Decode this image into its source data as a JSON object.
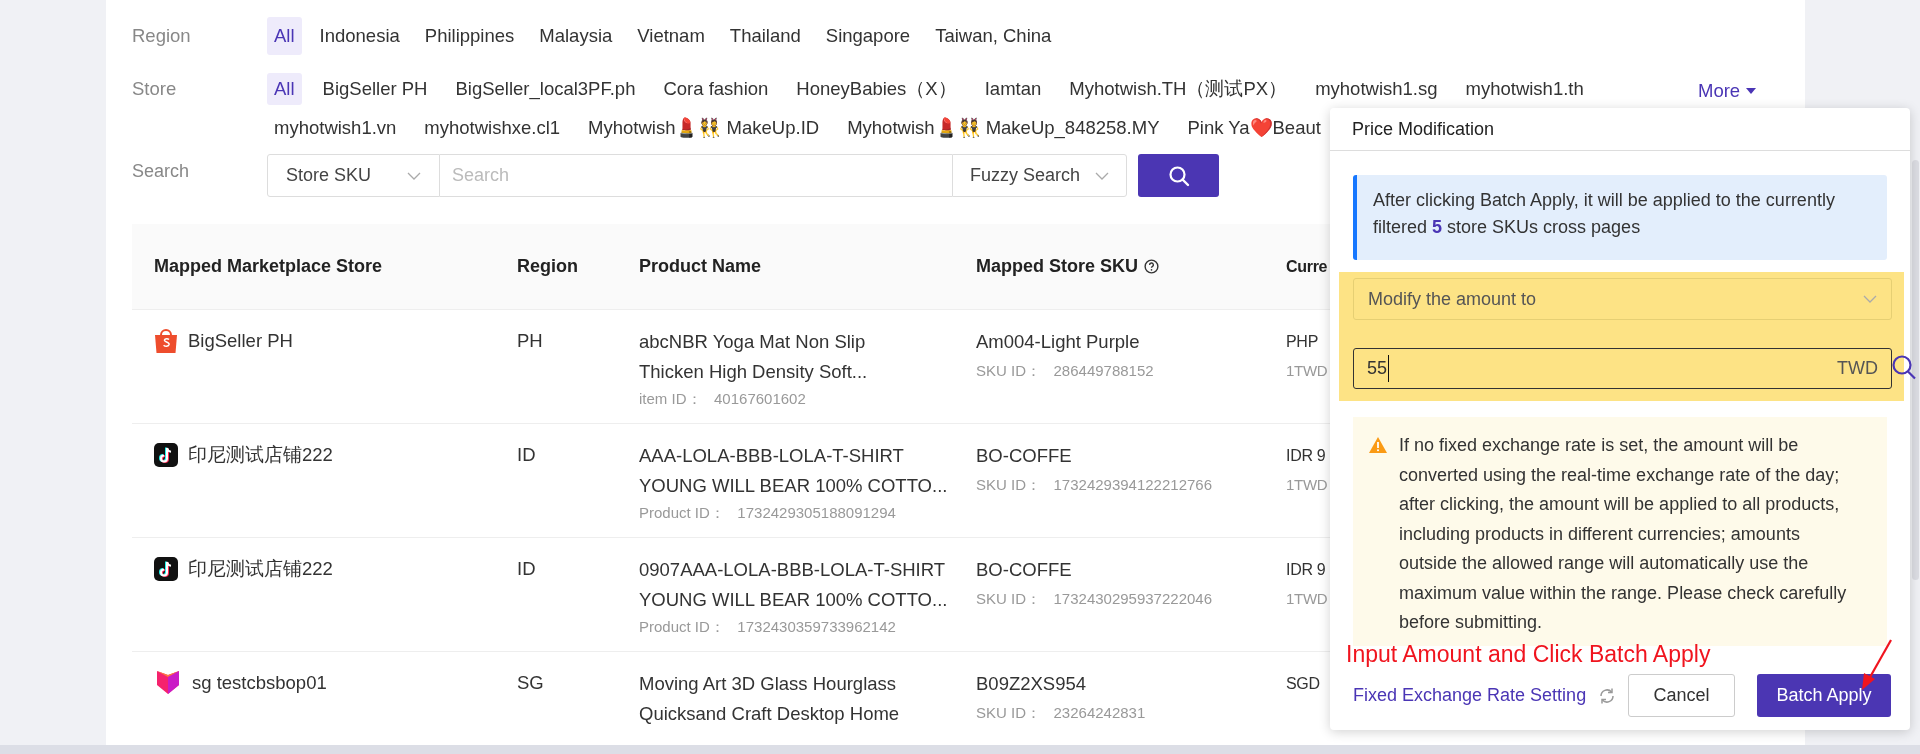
{
  "filters": {
    "region": {
      "label": "Region",
      "options": [
        {
          "label": "All",
          "selected": true
        },
        {
          "label": "Indonesia",
          "selected": false
        },
        {
          "label": "Philippines",
          "selected": false
        },
        {
          "label": "Malaysia",
          "selected": false
        },
        {
          "label": "Vietnam",
          "selected": false
        },
        {
          "label": "Thailand",
          "selected": false
        },
        {
          "label": "Singapore",
          "selected": false
        },
        {
          "label": "Taiwan, China",
          "selected": false
        }
      ]
    },
    "store": {
      "label": "Store",
      "more": "More",
      "options": [
        {
          "label": "All",
          "selected": true
        },
        {
          "label": "BigSeller PH",
          "selected": false
        },
        {
          "label": "BigSeller_local3PF.ph",
          "selected": false
        },
        {
          "label": "Cora fashion",
          "selected": false
        },
        {
          "label": "HoneyBabies（X）",
          "selected": false
        },
        {
          "label": "Iamtan",
          "selected": false
        },
        {
          "label": "Myhotwish.TH（测试PX）",
          "selected": false
        },
        {
          "label": "myhotwish1.sg",
          "selected": false
        },
        {
          "label": "myhotwish1.th",
          "selected": false
        },
        {
          "label": "myhotwish1.vn",
          "selected": false
        },
        {
          "label": "myhotwishxe.cl1",
          "selected": false
        },
        {
          "label": "Myhotwish💄👯 MakeUp.ID",
          "selected": false
        },
        {
          "label": "Myhotwish💄👯 MakeUp_848258.MY",
          "selected": false
        },
        {
          "label": "Pink Ya❤️Beaut",
          "selected": false
        }
      ]
    },
    "search": {
      "label": "Search",
      "field": "Store SKU",
      "placeholder": "Search",
      "match": "Fuzzy Search"
    }
  },
  "table": {
    "columns": [
      {
        "label": "Mapped Marketplace Store",
        "help": false
      },
      {
        "label": "Region",
        "help": false
      },
      {
        "label": "Product Name",
        "help": false
      },
      {
        "label": "Mapped Store SKU",
        "help": true
      },
      {
        "label": "Curre",
        "help": false
      }
    ],
    "rows": [
      {
        "store": {
          "kind": "shopee",
          "name": "BigSeller PH"
        },
        "region": "PH",
        "product": {
          "lines": [
            "abcNBR Yoga Mat Non Slip",
            "Thicken High Density Soft..."
          ],
          "id_label": "item ID：",
          "id": "40167601602"
        },
        "sku": {
          "name": "Am004-Light Purple",
          "id_label": "SKU ID：",
          "id": "286449788152"
        },
        "currency": [
          "PHP",
          "1TWD"
        ]
      },
      {
        "store": {
          "kind": "tiktok",
          "name": "印尼测试店铺222"
        },
        "region": "ID",
        "product": {
          "lines": [
            "AAA-LOLA-BBB-LOLA-T-SHIRT",
            "YOUNG WILL BEAR 100% COTTO..."
          ],
          "id_label": "Product ID：",
          "id": "1732429305188091294"
        },
        "sku": {
          "name": "BO-COFFE",
          "id_label": "SKU ID：",
          "id": "1732429394122212766"
        },
        "currency": [
          "IDR 9",
          "1TWD"
        ]
      },
      {
        "store": {
          "kind": "tiktok",
          "name": "印尼测试店铺222"
        },
        "region": "ID",
        "product": {
          "lines": [
            "0907AAA-LOLA-BBB-LOLA-T-SHIRT",
            "YOUNG WILL BEAR 100% COTTO..."
          ],
          "id_label": "Product ID：",
          "id": "1732430359733962142"
        },
        "sku": {
          "name": "BO-COFFE",
          "id_label": "SKU ID：",
          "id": "1732430295937222046"
        },
        "currency": [
          "IDR 9",
          "1TWD"
        ]
      },
      {
        "store": {
          "kind": "lazada",
          "name": "sg testcbsbop01"
        },
        "region": "SG",
        "product": {
          "lines": [
            "Moving Art 3D Glass Hourglass",
            "Quicksand Craft Desktop Home"
          ]
        },
        "sku": {
          "name": "B09Z2XS954",
          "id_label": "SKU ID：",
          "id": "23264242831"
        },
        "currency": [
          "SGD"
        ]
      }
    ]
  },
  "popup": {
    "title": "Price Modification",
    "info": "After clicking Batch Apply, it will be applied to the currently filtered **5** store SKUs cross pages",
    "mode": "Modify the amount to",
    "amount": "55",
    "unit": "TWD",
    "warning": "If no fixed exchange rate is set, the amount will be converted using the real-time exchange rate of the day; after clicking, the amount will be applied to all products, including products in different currencies; amounts outside the allowed range will automatically use the maximum value within the range. Please check carefully before submitting.",
    "annotation": "Input Amount and Click Batch Apply",
    "link": "Fixed Exchange Rate Setting",
    "buttons": [
      "Cancel",
      "Batch Apply"
    ]
  }
}
